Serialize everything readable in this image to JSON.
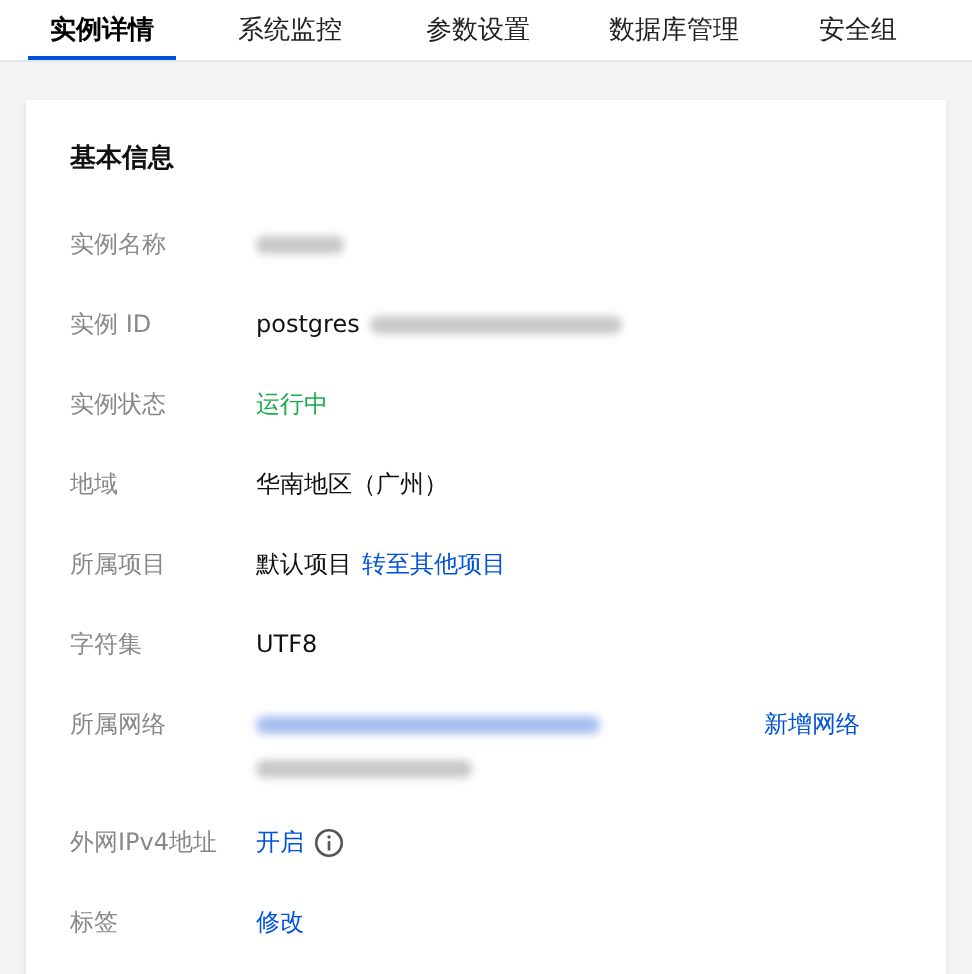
{
  "tabs": [
    {
      "label": "实例详情",
      "selected": true
    },
    {
      "label": "系统监控",
      "selected": false
    },
    {
      "label": "参数设置",
      "selected": false
    },
    {
      "label": "数据库管理",
      "selected": false
    },
    {
      "label": "安全组",
      "selected": false
    }
  ],
  "section": {
    "title": "基本信息"
  },
  "rows": [
    {
      "label": "实例名称",
      "lines": [
        [
          {
            "kind": "blurred"
          }
        ]
      ]
    },
    {
      "label": "实例 ID",
      "lines": [
        [
          {
            "kind": "text",
            "text": "postgres"
          },
          {
            "kind": "blurred"
          }
        ]
      ]
    },
    {
      "label": "实例状态",
      "lines": [
        [
          {
            "kind": "status",
            "text": "运行中"
          }
        ]
      ]
    },
    {
      "label": "地域",
      "lines": [
        [
          {
            "kind": "text",
            "text": "华南地区（广州）"
          }
        ]
      ]
    },
    {
      "label": "所属项目",
      "lines": [
        [
          {
            "kind": "text",
            "text": "默认项目"
          },
          {
            "kind": "link",
            "text": "转至其他项目"
          }
        ]
      ]
    },
    {
      "label": "字符集",
      "lines": [
        [
          {
            "kind": "text",
            "text": "UTF8"
          }
        ]
      ]
    },
    {
      "label": "所属网络",
      "lines": [
        [
          {
            "kind": "blurred_link"
          }
        ],
        [
          {
            "kind": "blurred"
          }
        ]
      ],
      "action": "新增网络"
    },
    {
      "label": "外网IPv4地址",
      "lines": [
        [
          {
            "kind": "link",
            "text": "开启"
          },
          {
            "kind": "info"
          }
        ]
      ]
    },
    {
      "label": "标签",
      "lines": [
        [
          {
            "kind": "link",
            "text": "修改"
          }
        ]
      ]
    }
  ]
}
